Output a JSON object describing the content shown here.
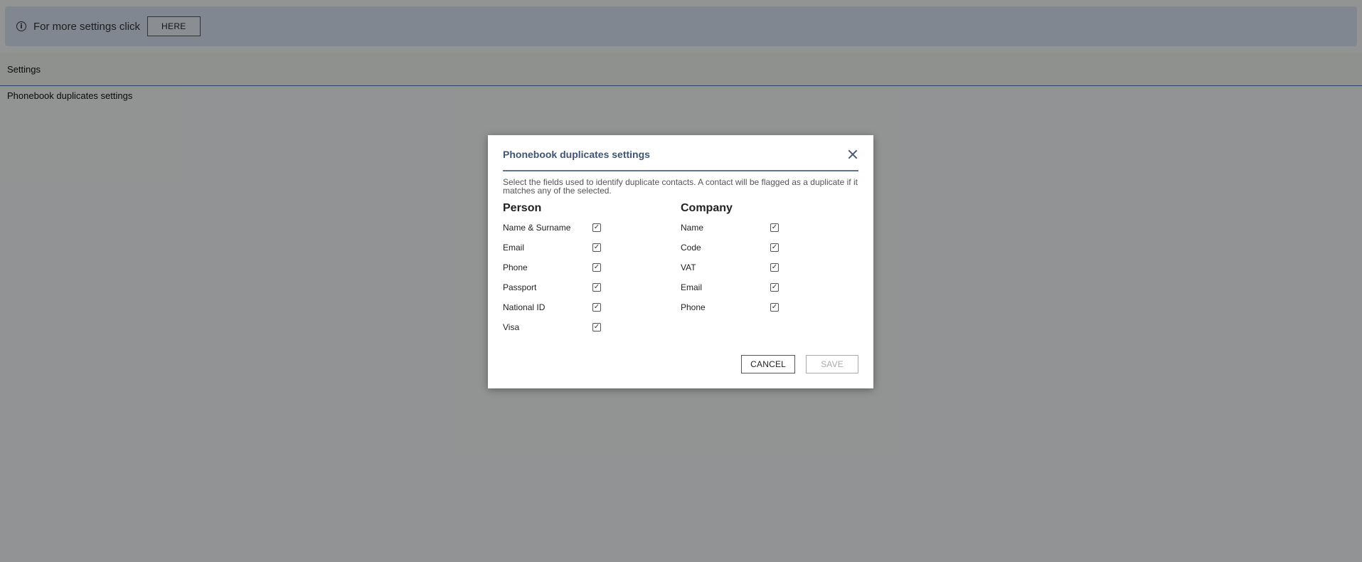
{
  "info_bar": {
    "icon": "info-icon",
    "icon_glyph": "i",
    "text": "For more settings click",
    "button_label": "HERE"
  },
  "page": {
    "header_title": "Settings",
    "sub_item": "Phonebook duplicates settings"
  },
  "modal": {
    "title": "Phonebook duplicates settings",
    "description": "Select the fields used to identify duplicate contacts. A contact will be flagged as a duplicate if it matches any of the selected.",
    "person": {
      "title": "Person",
      "fields": [
        {
          "label": "Name & Surname",
          "checked": true
        },
        {
          "label": "Email",
          "checked": true
        },
        {
          "label": "Phone",
          "checked": true
        },
        {
          "label": "Passport",
          "checked": true
        },
        {
          "label": "National ID",
          "checked": true
        },
        {
          "label": "Visa",
          "checked": true
        }
      ]
    },
    "company": {
      "title": "Company",
      "fields": [
        {
          "label": "Name",
          "checked": true
        },
        {
          "label": "Code",
          "checked": true
        },
        {
          "label": "VAT",
          "checked": true
        },
        {
          "label": "Email",
          "checked": true
        },
        {
          "label": "Phone",
          "checked": true
        }
      ]
    },
    "cancel_label": "CANCEL",
    "save_label": "SAVE",
    "check_glyph": "✓"
  },
  "colors": {
    "info_bar_bg": "#d7e2f0",
    "title": "#3f5573",
    "divider": "#5b7395",
    "header_border": "#4a6ea8"
  }
}
